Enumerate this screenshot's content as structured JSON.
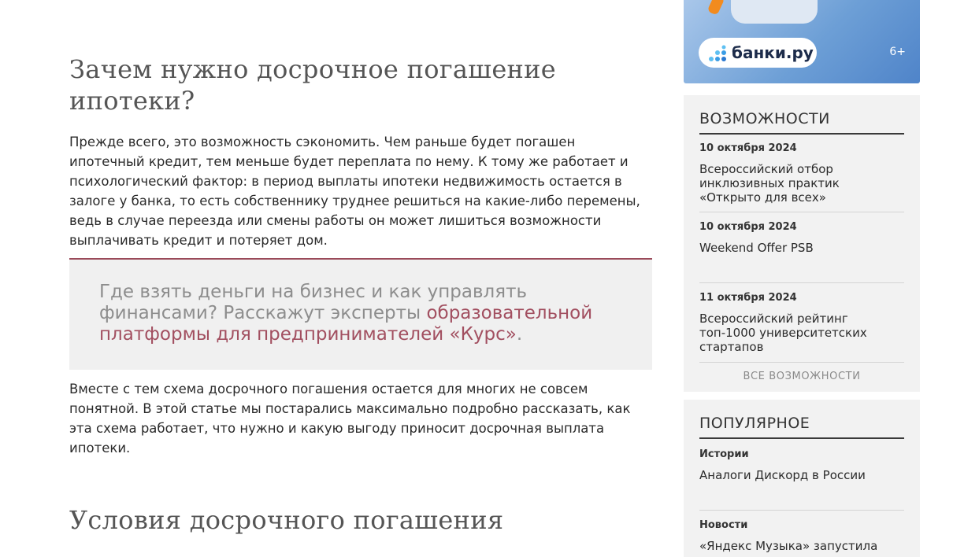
{
  "article": {
    "heading1": "Зачем нужно досрочное погашение ипотеки?",
    "paragraph1": "Прежде всего, это возможность сэкономить. Чем раньше будет погашен ипотечный кредит, тем меньше будет переплата по нему. К тому же работает и психологический фактор: в период выплаты ипотеки недвижимость остается в залоге у банка, то есть собственнику труднее решиться на какие-либо перемены, ведь в случае переезда или смены работы он может лишиться возможности выплачивать кредит и потеряет дом.",
    "callout_text": "Где взять деньги на бизнес и как управлять финансами? Расскажут эксперты ",
    "callout_link": "образовательной платформы для предпринимателей «Курс»",
    "callout_end": ".",
    "paragraph2": "Вместе с тем схема досрочного погашения остается для многих не совсем понятной. В этой статье мы постарались максимально подробно рассказать, как эта схема работает, что нужно и какую выгоду приносит досрочная выплата ипотеки.",
    "heading2": "Условия досрочного погашения"
  },
  "ad": {
    "logo_text": "банки.ру",
    "age_rating": "6+",
    "colors": {
      "background": "#6d9fd6",
      "accent": "#f28b1e"
    }
  },
  "opportunities": {
    "title": "ВОЗМОЖНОСТИ",
    "items": [
      {
        "date": "10 октября 2024",
        "title": "Всероссийский отбор инклюзивных практик «Открыто для всех»"
      },
      {
        "date": "10 октября 2024",
        "title": "Weekend Offer PSB"
      },
      {
        "date": "11 октября 2024",
        "title": "Всероссийский рейтинг топ-1000 университетских стартапов"
      }
    ],
    "all_link": "ВСЕ ВОЗМОЖНОСТИ"
  },
  "popular": {
    "title": "ПОПУЛЯРНОЕ",
    "items": [
      {
        "category": "Истории",
        "title": "Аналоги Дискорд в России"
      },
      {
        "category": "Новости",
        "title": "«Яндекс Музыка» запустила"
      }
    ]
  },
  "colors": {
    "link": "#a24f60",
    "callout_border": "#9a4a5a",
    "callout_bg": "#f0f0f0",
    "sidebar_bg": "#f2f2f2"
  }
}
